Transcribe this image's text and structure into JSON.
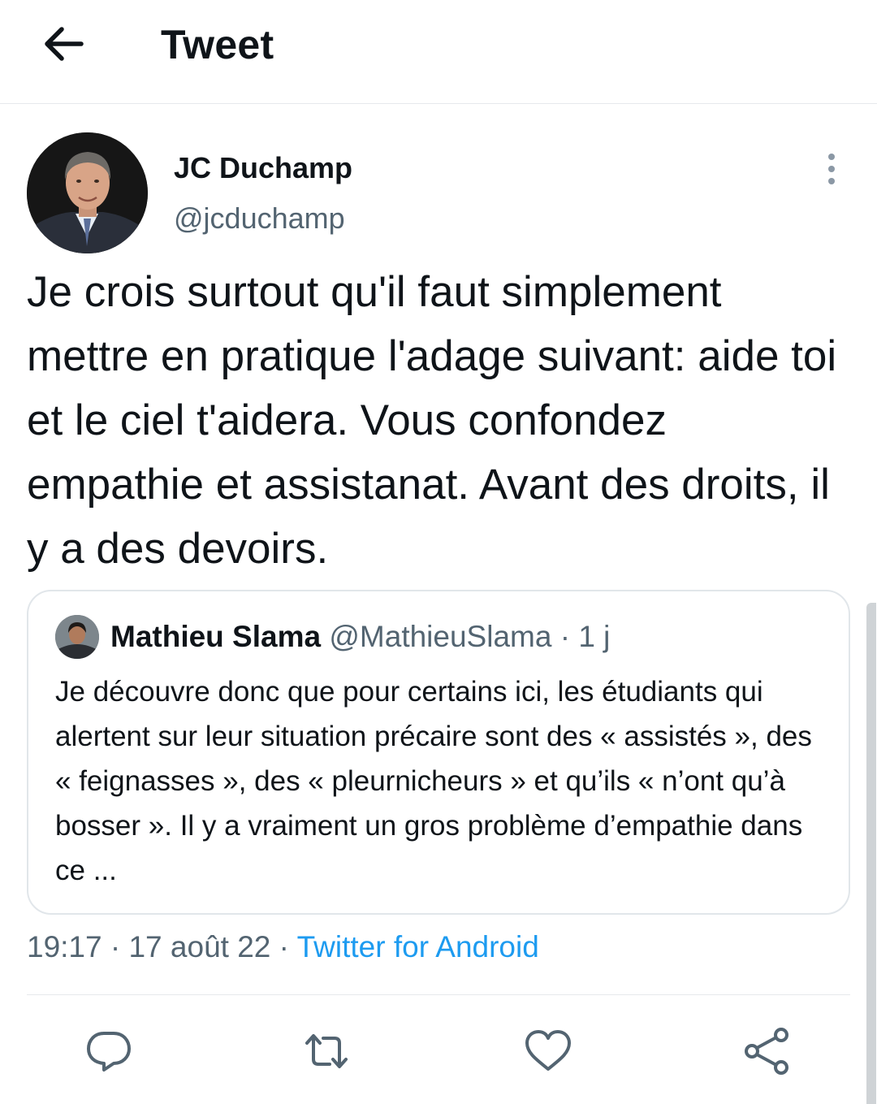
{
  "header": {
    "title": "Tweet",
    "back_icon": "arrow-left-icon"
  },
  "tweet": {
    "author": {
      "name": "JC Duchamp",
      "handle": "@jcduchamp"
    },
    "text": "Je crois surtout qu'il faut simplement mettre en pratique l'adage suivant: aide toi et le ciel t'aidera. Vous confondez empathie et assistanat. Avant des droits, il y a des devoirs.",
    "time": "19:17",
    "date": "17 août 22",
    "source": "Twitter for Android",
    "separator": "·"
  },
  "quoted": {
    "name": "Mathieu Slama",
    "handle": "@MathieuSlama",
    "age": "1 j",
    "text": "Je découvre donc que pour certains ici, les étudiants qui alertent sur leur situation précaire sont des « assistés », des « feignasses », des « pleurnicheurs » et qu’ils « n’ont qu’à bosser ». Il y a vraiment un gros problème d’empathie dans ce ..."
  },
  "actions": [
    "reply-icon",
    "retweet-icon",
    "like-icon",
    "share-icon"
  ],
  "colors": {
    "accent": "#1d9bf0",
    "muted": "#536471",
    "text": "#0f1419",
    "border": "#e1e6ea"
  }
}
